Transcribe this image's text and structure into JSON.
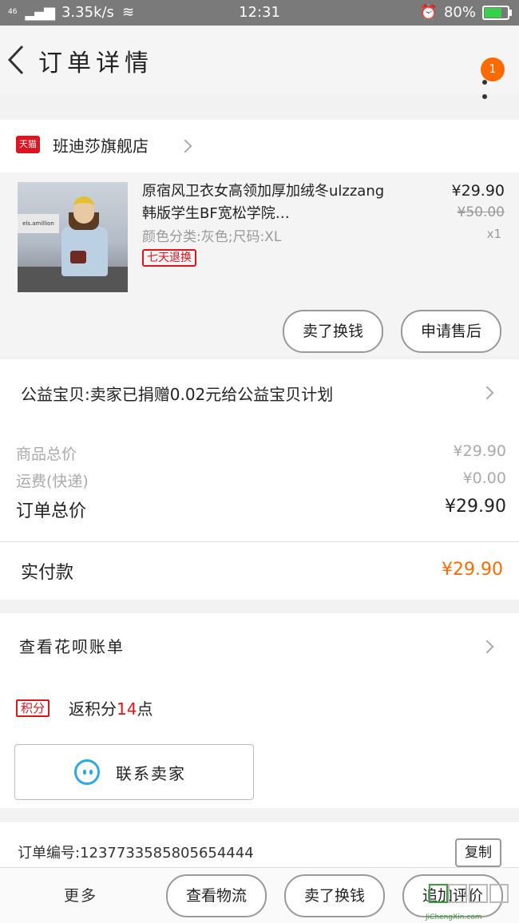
{
  "status_bar": {
    "network": "46",
    "speed": "3.35k/s",
    "time": "12:31",
    "battery": "80%",
    "battery_level": 0.8
  },
  "header": {
    "title": "订单详情",
    "badge_count": "1"
  },
  "store": {
    "badge": "天猫",
    "name": "班迪莎旗舰店"
  },
  "product": {
    "title": "原宿风卫衣女高领加厚加绒冬ulzzang韩版学生BF宽松学院…",
    "spec": "颜色分类:灰色;尺码:XL",
    "tag": "七天退换",
    "price": "¥29.90",
    "original_price": "¥50.00",
    "quantity": "x1",
    "image_sign_text": "els.amillion",
    "actions": [
      "卖了换钱",
      "申请售后"
    ]
  },
  "charity": {
    "text": "公益宝贝:卖家已捐赠0.02元给公益宝贝计划"
  },
  "totals": {
    "goods_label": "商品总价",
    "goods_value": "¥29.90",
    "shipping_label": "运费(快递)",
    "shipping_value": "¥0.00",
    "order_label": "订单总价",
    "order_value": "¥29.90"
  },
  "paid": {
    "label": "实付款",
    "value": "¥29.90"
  },
  "huabei": {
    "label": "查看花呗账单"
  },
  "points": {
    "badge": "积分",
    "prefix": "返积分",
    "count": "14",
    "suffix": "点"
  },
  "contact": {
    "label": "联系卖家"
  },
  "order": {
    "number_text": "订单编号:1237733585805654444",
    "copy_label": "复制"
  },
  "bottom_bar": {
    "more": "更多",
    "logistics": "查看物流",
    "sell_exchange": "卖了换钱",
    "review": "追加评价"
  },
  "watermark": {
    "url": "JiChengXin.com"
  },
  "colors": {
    "accent_orange": "#ff6a00",
    "tmall_red": "#e0141e",
    "contact_blue": "#2fa8e8"
  }
}
